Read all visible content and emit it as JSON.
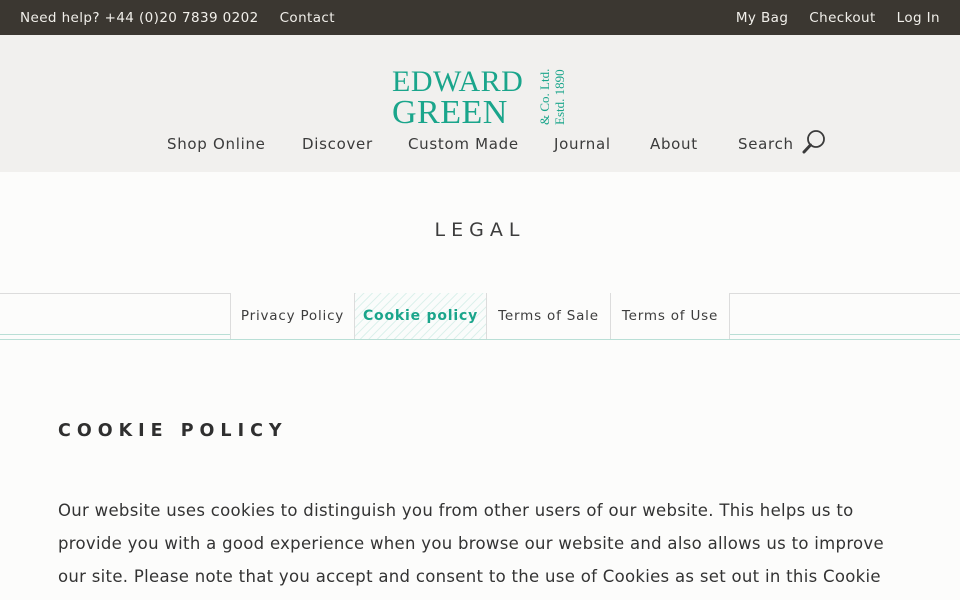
{
  "topbar": {
    "help": "Need help? +44 (0)20 7839 0202",
    "contact": "Contact",
    "bag": "My Bag",
    "checkout": "Checkout",
    "login": "Log In"
  },
  "logo": {
    "line1": "EDWARD",
    "line2": "GREEN",
    "side1": "& Co. Ltd.",
    "side2": "Estd. 1890",
    "color": "#1aa58b"
  },
  "nav": {
    "items": [
      "Shop Online",
      "Discover",
      "Custom Made",
      "Journal",
      "About",
      "Search"
    ],
    "search_icon": "magnifier-icon"
  },
  "hero": {
    "title": "LEGAL"
  },
  "tabs": {
    "items": [
      "Privacy Policy",
      "Cookie policy",
      "Terms of Sale",
      "Terms of Use"
    ],
    "active": "Cookie policy"
  },
  "content": {
    "title": "COOKIE POLICY",
    "body": "Our website uses cookies to distinguish you from other users of our website. This helps us to provide you with a good experience when you browse our website and also allows us to improve our site. Please note that you accept and consent to the use of Cookies as set out in this Cookie Policy by visiting and"
  },
  "colors": {
    "topbar_bg": "#3b3731",
    "header_bg": "#f1f0ee",
    "accent": "#1aa58b"
  }
}
